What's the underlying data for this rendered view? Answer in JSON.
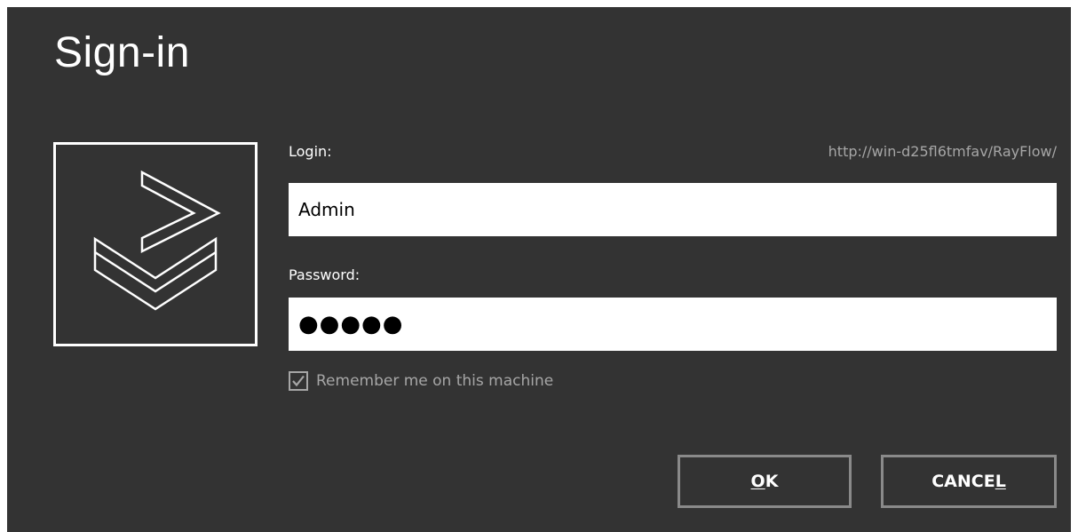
{
  "dialog": {
    "title": "Sign-in",
    "server_url": "http://win-d25fl6tmfav/RayFlow/"
  },
  "login": {
    "label": "Login:",
    "value": "Admin"
  },
  "password": {
    "label": "Password:",
    "masked_value": "●●●●●"
  },
  "remember": {
    "label": "Remember me on this machine",
    "checked": true
  },
  "buttons": {
    "ok": {
      "label": "OK",
      "mnemonic": "O",
      "rest": "K"
    },
    "cancel": {
      "label": "CANCEL",
      "prefix": "CANCE",
      "mnemonic": "L"
    }
  },
  "colors": {
    "background": "#333333",
    "text": "#ffffff",
    "muted": "#a6a6a6",
    "button_border": "#8a8a8a",
    "input_background": "#ffffff"
  },
  "icons": {
    "logo": "rayflow-logo-icon",
    "check": "checkmark-icon"
  }
}
